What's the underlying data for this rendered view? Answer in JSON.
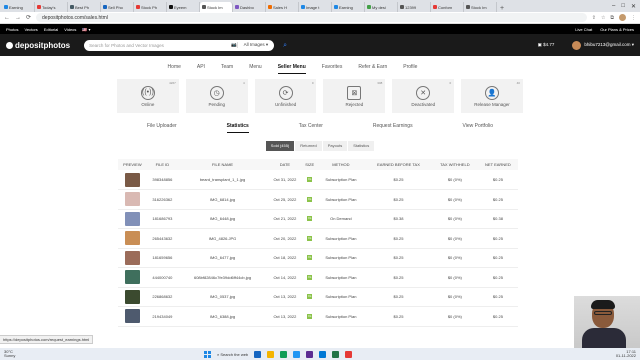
{
  "browser": {
    "tabs": [
      {
        "title": "Earning",
        "color": "#1e88e5"
      },
      {
        "title": "Today's",
        "color": "#e53935"
      },
      {
        "title": "Best Ph",
        "color": "#455a64"
      },
      {
        "title": "Sell Pho",
        "color": "#1565c0"
      },
      {
        "title": "Stock Ph",
        "color": "#e53935"
      },
      {
        "title": "Eyeem",
        "color": "#111111"
      },
      {
        "title": "Stock Im",
        "color": "#555555",
        "active": true
      },
      {
        "title": "Dashbo",
        "color": "#7e57c2"
      },
      {
        "title": "Sales H",
        "color": "#ef6c00"
      },
      {
        "title": "Image t",
        "color": "#1e88e5"
      },
      {
        "title": "Earning",
        "color": "#1e88e5"
      },
      {
        "title": "My desi",
        "color": "#43a047"
      },
      {
        "title": "12399",
        "color": "#555555"
      },
      {
        "title": "Conforn",
        "color": "#e53935"
      },
      {
        "title": "Stock Im",
        "color": "#555555"
      }
    ],
    "url": "depositphotos.com/sales.html",
    "new_tab": "+",
    "win_controls": [
      "–",
      "□",
      "✕"
    ]
  },
  "top_links": {
    "left": [
      "Photos",
      "Vectors",
      "Editorial",
      "Videos"
    ],
    "flag": "🇺🇸 ▾",
    "right": [
      "Live Chat",
      "Our Plans & Prices"
    ]
  },
  "header": {
    "logo": "depositphotos",
    "search_placeholder": "Search for Photos and Vector Images",
    "search_dropdown": "All Images ▾",
    "balance": "$4.77",
    "user": "bhibu7213@gmail.com ▾"
  },
  "main_menu": [
    "Home",
    "API",
    "Team",
    "Menu",
    "Seller Menu",
    "Favorites",
    "Refer & Earn",
    "Profile"
  ],
  "main_menu_active": 4,
  "status_cards": [
    {
      "label": "Online",
      "count": "4267",
      "icon": "((•))"
    },
    {
      "label": "Pending",
      "count": "4",
      "icon": "◷"
    },
    {
      "label": "Unfinished",
      "count": "0",
      "icon": "⟳"
    },
    {
      "label": "Rejected",
      "count": "308",
      "icon": "⊠"
    },
    {
      "label": "Deactivated",
      "count": "0",
      "icon": "✕"
    },
    {
      "label": "Release Manager",
      "count": "40",
      "icon": "👤"
    }
  ],
  "sub_tabs": [
    "File Uploader",
    "Statistics",
    "Tax Center",
    "Request Earnings",
    "View Portfolio"
  ],
  "sub_tabs_active": 1,
  "filters": [
    "Sold (455)",
    "Returned",
    "Payouts",
    "Statistics"
  ],
  "filters_active": 0,
  "table": {
    "headers": [
      "PREVIEW",
      "FILE ID",
      "FILE NAME",
      "DATE",
      "SIZE",
      "METHOD",
      "EARNED BEFORE TAX",
      "TAX WITHHELD",
      "NET EARNED"
    ],
    "rows": [
      {
        "thumb": "#7a5a46",
        "id": "398348856",
        "name": "beard_transplant_1_1.jpg",
        "date": "Oct 31, 2022",
        "size": "XL",
        "method": "Subscription Plan",
        "earned": "$0.25",
        "tax": "$0 (0%)",
        "net": "$0.25"
      },
      {
        "thumb": "#d9b9b3",
        "id": "316226362",
        "name": "IMG_6814.jpg",
        "date": "Oct 25, 2022",
        "size": "XL",
        "method": "Subscription Plan",
        "earned": "$0.25",
        "tax": "$0 (0%)",
        "net": "$0.25"
      },
      {
        "thumb": "#8190b8",
        "id": "181686793",
        "name": "IMG_6448.jpg",
        "date": "Oct 21, 2022",
        "size": "XL",
        "method": "On Demand",
        "earned": "$0.38",
        "tax": "$0 (0%)",
        "net": "$0.38"
      },
      {
        "thumb": "#c98e55",
        "id": "265443632",
        "name": "IMG_4826.JPG",
        "date": "Oct 20, 2022",
        "size": "XL",
        "method": "Subscription Plan",
        "earned": "$0.25",
        "tax": "$0 (0%)",
        "net": "$0.25"
      },
      {
        "thumb": "#9b6c5a",
        "id": "181659656",
        "name": "IMG_6477.jpg",
        "date": "Oct 18, 2022",
        "size": "XL",
        "method": "Subscription Plan",
        "earned": "$0.25",
        "tax": "$0 (0%)",
        "net": "$0.25"
      },
      {
        "thumb": "#3f6f5d",
        "id": "444000740",
        "name": "608bf82846c7fe39dd6ff44cb.jpg",
        "date": "Oct 14, 2022",
        "size": "XL",
        "method": "Subscription Plan",
        "earned": "$0.25",
        "tax": "$0 (0%)",
        "net": "$0.25"
      },
      {
        "thumb": "#3b4a2f",
        "id": "226868632",
        "name": "IMG_0537.jpg",
        "date": "Oct 13, 2022",
        "size": "XL",
        "method": "Subscription Plan",
        "earned": "$0.25",
        "tax": "$0 (0%)",
        "net": "$0.25"
      },
      {
        "thumb": "#4e5a6e",
        "id": "219434049",
        "name": "IMG_6388.jpg",
        "date": "Oct 13, 2022",
        "size": "XL",
        "method": "Subscription Plan",
        "earned": "$0.25",
        "tax": "$0 (0%)",
        "net": "$0.25"
      }
    ]
  },
  "status_url": "https://depositphotos.com/request_earnings.html",
  "taskbar": {
    "temp": "30°C",
    "weather": "Sunny",
    "search": "Search the web",
    "time": "17:11",
    "date": "01-11-2022"
  }
}
